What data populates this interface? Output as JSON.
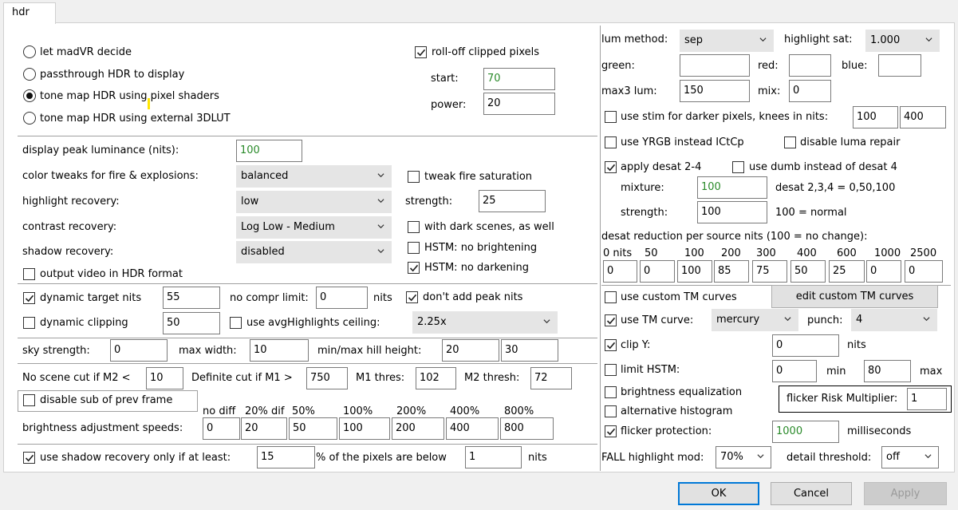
{
  "tab": {
    "label": "hdr"
  },
  "left": {
    "radios": [
      {
        "label": "let madVR decide",
        "checked": false
      },
      {
        "label": "passthrough HDR to display",
        "checked": false
      },
      {
        "label": "tone map HDR using pixel shaders",
        "checked": true
      },
      {
        "label": "tone map HDR using external 3DLUT",
        "checked": false
      }
    ],
    "rolloff": {
      "label": "roll-off clipped pixels",
      "checked": true,
      "start_label": "start:",
      "start_value": "70",
      "power_label": "power:",
      "power_value": "20"
    },
    "peak": {
      "label": "display peak luminance (nits):",
      "value": "100"
    },
    "color_tweaks": {
      "label": "color tweaks for fire & explosions:",
      "value": "balanced"
    },
    "tweak_fire": {
      "label": "tweak fire saturation",
      "checked": false
    },
    "highlight_recovery": {
      "label": "highlight recovery:",
      "value": "low"
    },
    "strength": {
      "label": "strength:",
      "value": "25"
    },
    "contrast_recovery": {
      "label": "contrast recovery:",
      "value": "Log Low - Medium"
    },
    "dark_scenes": {
      "label": "with dark scenes, as well",
      "checked": false
    },
    "shadow_recovery": {
      "label": "shadow recovery:",
      "value": "disabled"
    },
    "hstm_no_bright": {
      "label": "HSTM: no brightening",
      "checked": false
    },
    "hstm_no_dark": {
      "label": "HSTM: no darkening",
      "checked": true
    },
    "output_hdr": {
      "label": "output video in HDR format",
      "checked": false
    },
    "dynamic_target": {
      "label": "dynamic target nits",
      "checked": true,
      "value": "55"
    },
    "no_compr": {
      "label": "no compr limit:",
      "value": "0",
      "unit": "nits"
    },
    "dont_add_peak": {
      "label": "don't add peak nits",
      "checked": true
    },
    "dynamic_clipping": {
      "label": "dynamic clipping",
      "checked": false,
      "value": "50"
    },
    "avg_highlights": {
      "label": "use avgHighlights ceiling:",
      "checked": false,
      "value": "2.25x"
    },
    "sky": {
      "label": "sky strength:",
      "value": "0",
      "max_width_label": "max width:",
      "max_width": "10",
      "hill_label": "min/max hill height:",
      "hill_min": "20",
      "hill_max": "30"
    },
    "scene_cut": {
      "no_cut_label": "No scene cut if M2 <",
      "no_cut": "10",
      "def_cut_label": "Definite cut if M1 >",
      "def_cut": "750",
      "m1_label": "M1 thres:",
      "m1": "102",
      "m2_label": "M2 thresh:",
      "m2": "72"
    },
    "disable_sub": {
      "label": "disable sub of prev frame",
      "checked": false
    },
    "speeds": {
      "label": "brightness adjustment speeds:",
      "headers": [
        "no diff",
        "20% dif",
        "50%",
        "100%",
        "200%",
        "400%",
        "800%"
      ],
      "values": [
        "0",
        "20",
        "50",
        "100",
        "200",
        "400",
        "800"
      ]
    },
    "shadow_only": {
      "label": "use shadow recovery only if at least:",
      "checked": true,
      "value": "15",
      "mid": "% of the pixels are below",
      "value2": "1",
      "unit": "nits"
    }
  },
  "right": {
    "lum_method": {
      "label": "lum method:",
      "value": "sep"
    },
    "highlight_sat": {
      "label": "highlight sat:",
      "value": "1.000"
    },
    "green_label": "green:",
    "green": "",
    "red_label": "red:",
    "red": "",
    "blue_label": "blue:",
    "blue": "",
    "max3": {
      "label": "max3 lum:",
      "value": "150",
      "mix_label": "mix:",
      "mix": "0"
    },
    "stim": {
      "label": "use stim for darker pixels, knees in nits:",
      "checked": false,
      "v1": "100",
      "v2": "400"
    },
    "yrgb": {
      "label": "use YRGB instead ICtCp",
      "checked": false
    },
    "luma_repair": {
      "label": "disable luma repair",
      "checked": false
    },
    "desat": {
      "label": "apply desat 2-4",
      "checked": true
    },
    "dumb_desat": {
      "label": "use dumb instead of desat 4",
      "checked": false
    },
    "mixture": {
      "label": "mixture:",
      "value": "100",
      "note": "desat 2,3,4 = 0,50,100"
    },
    "desat_strength": {
      "label": "strength:",
      "value": "100",
      "note": "100 = normal"
    },
    "desat_reduction": {
      "label": "desat reduction per source nits (100 = no change):",
      "headers": [
        "0 nits",
        "50",
        "100",
        "200",
        "300",
        "400",
        "600",
        "1000",
        "2500"
      ],
      "values": [
        "0",
        "0",
        "100",
        "85",
        "75",
        "50",
        "25",
        "0",
        "0"
      ]
    },
    "custom_tm": {
      "label": "use custom TM curves",
      "checked": false,
      "button": "edit custom TM curves"
    },
    "tm_curve": {
      "label": "use TM curve:",
      "checked": true,
      "value": "mercury",
      "punch_label": "punch:",
      "punch": "4"
    },
    "clip_y": {
      "label": "clip Y:",
      "checked": true,
      "value": "0",
      "unit": "nits"
    },
    "limit_hstm": {
      "label": "limit HSTM:",
      "checked": false,
      "min": "0",
      "min_label": "min",
      "max": "80",
      "max_label": "max"
    },
    "brightness_eq": {
      "label": "brightness equalization",
      "checked": false
    },
    "flicker_risk": {
      "label": "flicker Risk Multiplier:",
      "value": "1"
    },
    "alt_hist": {
      "label": "alternative histogram",
      "checked": false
    },
    "flicker_prot": {
      "label": "flicker protection:",
      "checked": true,
      "value": "1000",
      "unit": "milliseconds"
    },
    "fall": {
      "label": "FALL highlight mod:",
      "value": "70%"
    },
    "detail": {
      "label": "detail threshold:",
      "value": "off"
    }
  },
  "buttons": {
    "ok": "OK",
    "cancel": "Cancel",
    "apply": "Apply"
  }
}
